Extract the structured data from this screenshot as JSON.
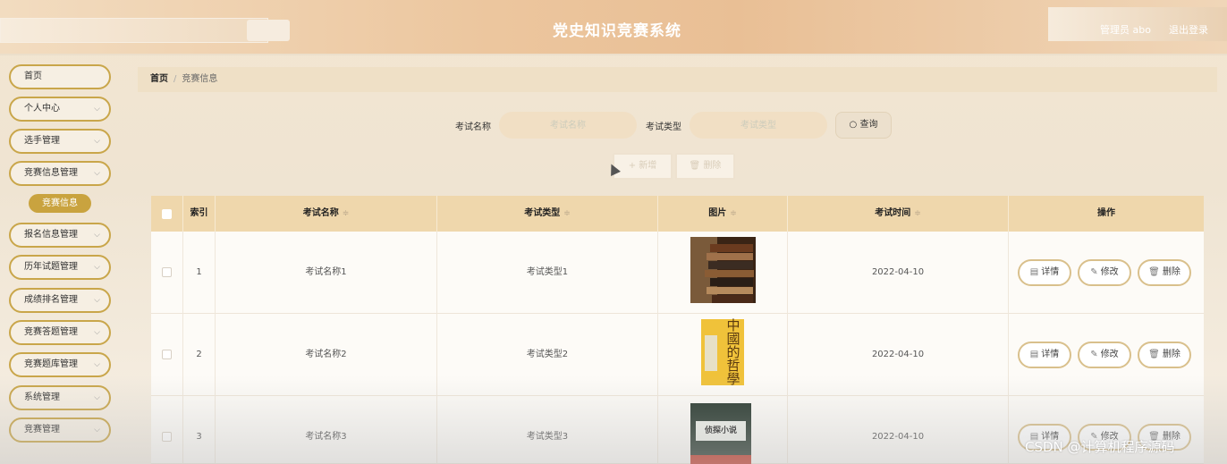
{
  "header": {
    "title": "党史知识竞赛系统",
    "user": "管理员 abo",
    "logout": "退出登录"
  },
  "sidebar": {
    "items": [
      {
        "label": "首页",
        "chevron": false
      },
      {
        "label": "个人中心",
        "chevron": true
      },
      {
        "label": "选手管理",
        "chevron": true
      },
      {
        "label": "竞赛信息管理",
        "chevron": true
      },
      {
        "label": "报名信息管理",
        "chevron": true
      },
      {
        "label": "历年试题管理",
        "chevron": true
      },
      {
        "label": "成绩排名管理",
        "chevron": true
      },
      {
        "label": "竞赛答题管理",
        "chevron": true
      },
      {
        "label": "竞赛题库管理",
        "chevron": true
      },
      {
        "label": "系统管理",
        "chevron": true
      },
      {
        "label": "竞赛管理",
        "chevron": true
      }
    ],
    "active_sub": "竞赛信息"
  },
  "breadcrumb": {
    "home": "首页",
    "sep": "/",
    "current": "竞赛信息"
  },
  "search": {
    "name_label": "考试名称",
    "name_placeholder": "考试名称",
    "type_label": "考试类型",
    "type_placeholder": "考试类型",
    "button": "查询",
    "button_icon": "search-icon"
  },
  "actions": {
    "add": "+ 新增",
    "delete": "删除"
  },
  "table": {
    "columns": [
      "索引",
      "考试名称",
      "考试类型",
      "图片",
      "考试时间",
      "操作"
    ],
    "sort_icon": "≑",
    "rows": [
      {
        "index": "1",
        "name": "考试名称1",
        "type": "考试类型1",
        "image": "stacked-books",
        "time": "2022-04-10"
      },
      {
        "index": "2",
        "name": "考试名称2",
        "type": "考试类型2",
        "image": "chinese-philosophy-book",
        "time": "2022-04-10"
      },
      {
        "index": "3",
        "name": "考试名称3",
        "type": "考试类型3",
        "image": "detective-novel-book",
        "time": "2022-04-10"
      }
    ],
    "op_labels": {
      "detail": "详情",
      "edit": "修改",
      "delete": "删除"
    }
  },
  "book2_text": "中國的哲學",
  "book3_text": "侦探小说",
  "watermark": "CSDN @计算机程序源码"
}
